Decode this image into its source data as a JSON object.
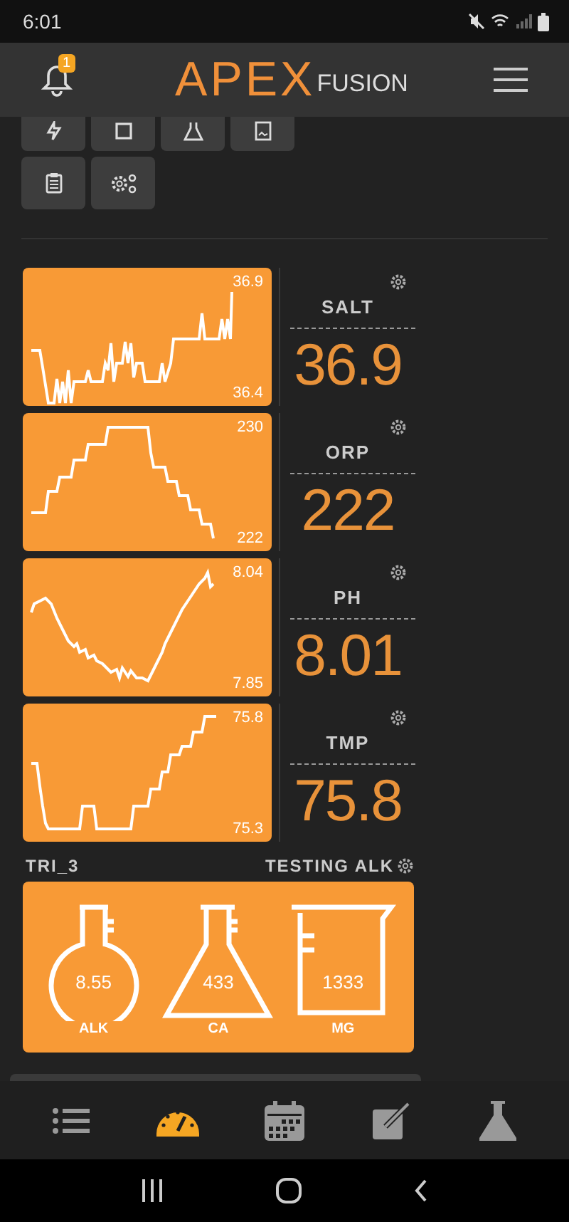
{
  "status_bar": {
    "time": "6:01"
  },
  "header": {
    "notification_count": "1",
    "logo_main": "APEX",
    "logo_sub": "FUSION"
  },
  "quick_buttons": [
    {
      "kind": "bolt"
    },
    {
      "kind": "square"
    },
    {
      "kind": "flask"
    },
    {
      "kind": "image"
    },
    {
      "kind": "clipboard"
    },
    {
      "kind": "gears"
    }
  ],
  "probes": [
    {
      "name": "SALT",
      "value": "36.9",
      "max": "36.9",
      "min": "36.4"
    },
    {
      "name": "ORP",
      "value": "222",
      "max": "230",
      "min": "222"
    },
    {
      "name": "PH",
      "value": "8.01",
      "max": "8.04",
      "min": "7.85"
    },
    {
      "name": "TMP",
      "value": "75.8",
      "max": "75.8",
      "min": "75.3"
    }
  ],
  "trident": {
    "name": "TRI_3",
    "status": "TESTING ALK",
    "tests": [
      {
        "kind": "round-flask",
        "value": "8.55",
        "label": "ALK"
      },
      {
        "kind": "erlenmeyer",
        "value": "433",
        "label": "CA"
      },
      {
        "kind": "beaker",
        "value": "1333",
        "label": "MG"
      }
    ]
  },
  "bottom_nav": [
    {
      "kind": "list",
      "selected": false
    },
    {
      "kind": "gauge",
      "selected": true
    },
    {
      "kind": "calendar",
      "selected": false
    },
    {
      "kind": "note",
      "selected": false
    },
    {
      "kind": "flask",
      "selected": false
    }
  ]
}
